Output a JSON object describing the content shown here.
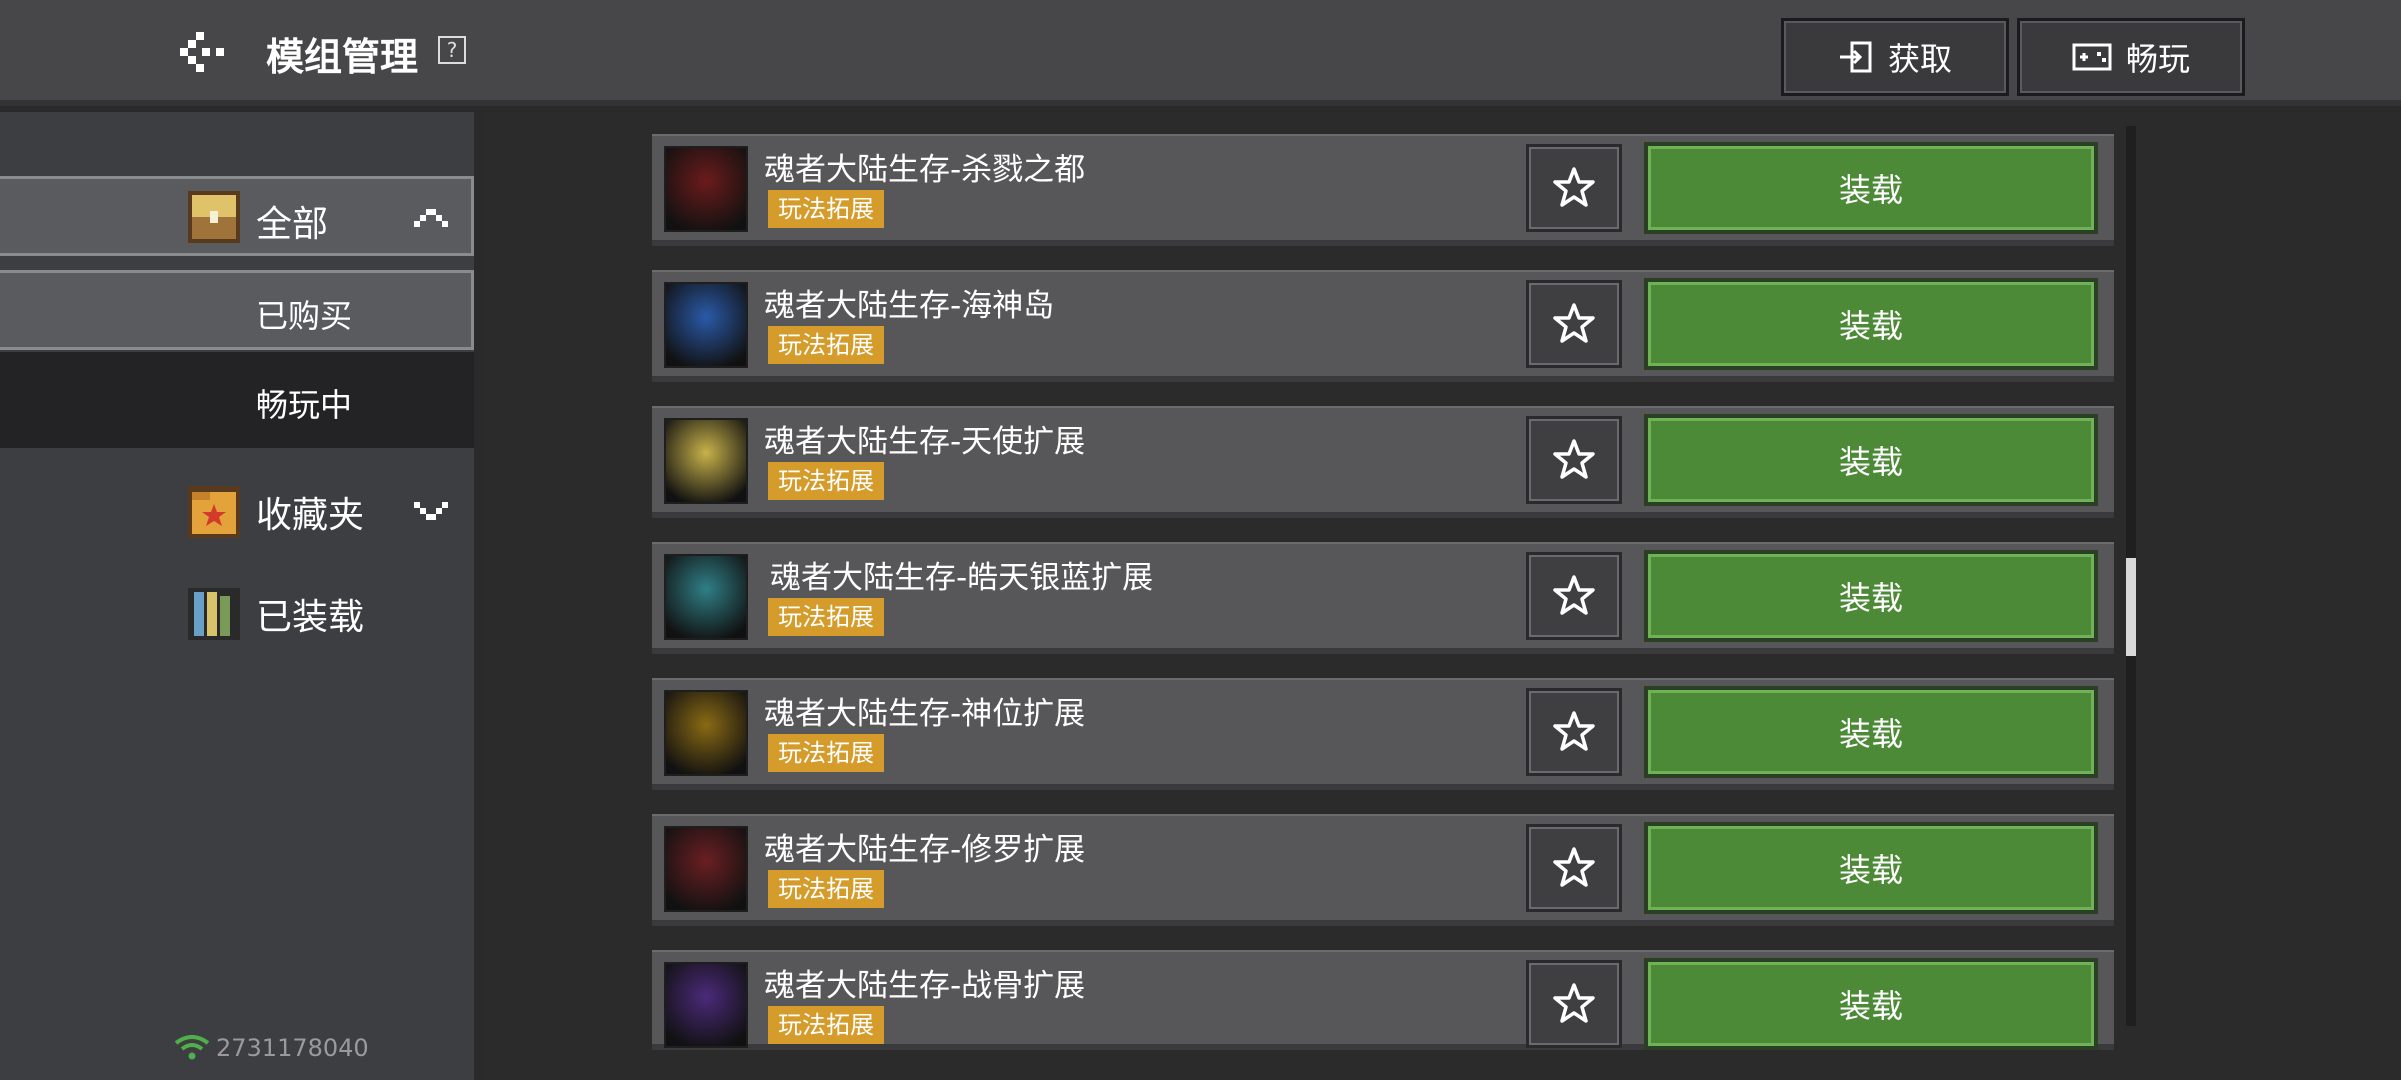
{
  "header": {
    "title": "模组管理",
    "help_label": "?",
    "get_label": "获取",
    "play_label": "畅玩"
  },
  "sidebar": {
    "all_label": "全部",
    "bought_label": "已购买",
    "playing_label": "畅玩中",
    "fav_label": "收藏夹",
    "loaded_label": "已装载",
    "network_id": "2731178040"
  },
  "mods": [
    {
      "title": "魂者大陆生存-杀戮之都",
      "tag": "玩法拓展",
      "action": "装载",
      "thumb_color": "#6b1b1b"
    },
    {
      "title": "魂者大陆生存-海神岛",
      "tag": "玩法拓展",
      "action": "装载",
      "thumb_color": "#2a5aa8"
    },
    {
      "title": "魂者大陆生存-天使扩展",
      "tag": "玩法拓展",
      "action": "装载",
      "thumb_color": "#c8b24a"
    },
    {
      "title": "魂者大陆生存-皓天银蓝扩展",
      "tag": "玩法拓展",
      "action": "装载",
      "thumb_color": "#2f7f86"
    },
    {
      "title": "魂者大陆生存-神位扩展",
      "tag": "玩法拓展",
      "action": "装载",
      "thumb_color": "#8a6a12"
    },
    {
      "title": "魂者大陆生存-修罗扩展",
      "tag": "玩法拓展",
      "action": "装载",
      "thumb_color": "#6a1f22"
    },
    {
      "title": "魂者大陆生存-战骨扩展",
      "tag": "玩法拓展",
      "action": "装载",
      "thumb_color": "#4b2a7a"
    }
  ],
  "colors": {
    "accent_green": "#4c8a37",
    "tag_orange": "#d59c2c"
  }
}
